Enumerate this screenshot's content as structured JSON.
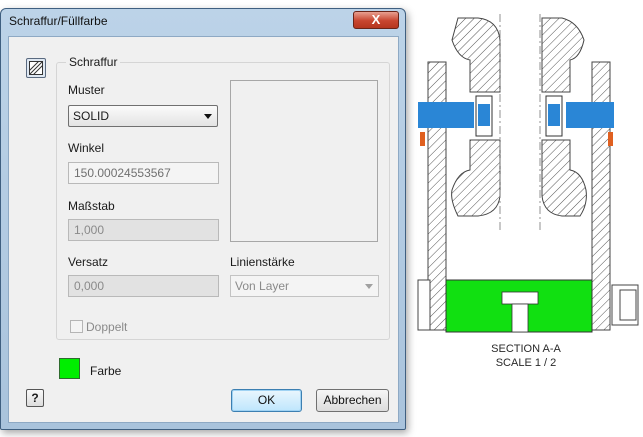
{
  "dialog": {
    "title": "Schraffur/Füllfarbe",
    "close_symbol": "X",
    "group_label": "Schraffur",
    "pattern_label": "Muster",
    "pattern_value": "SOLID",
    "angle_label": "Winkel",
    "angle_value": "150.00024553567",
    "scale_label": "Maßstab",
    "scale_value": "1,000",
    "offset_label": "Versatz",
    "offset_value": "0,000",
    "lineweight_label": "Linienstärke",
    "lineweight_value": "Von Layer",
    "double_label": "Doppelt",
    "double_checked": false,
    "color_label": "Farbe",
    "color_value": "#00ee00",
    "help_symbol": "?",
    "ok_label": "OK",
    "cancel_label": "Abbrechen",
    "icons": [
      "hatch-icon",
      "close-icon",
      "help-icon",
      "chevron-down-icon"
    ]
  },
  "drawing": {
    "caption_line1": "SECTION A-A",
    "caption_line2": "SCALE 1 / 2",
    "colors": {
      "shaft": "#2a86d6",
      "fill": "#11e011",
      "hatch": "#555555",
      "washer": "#e06020"
    }
  }
}
